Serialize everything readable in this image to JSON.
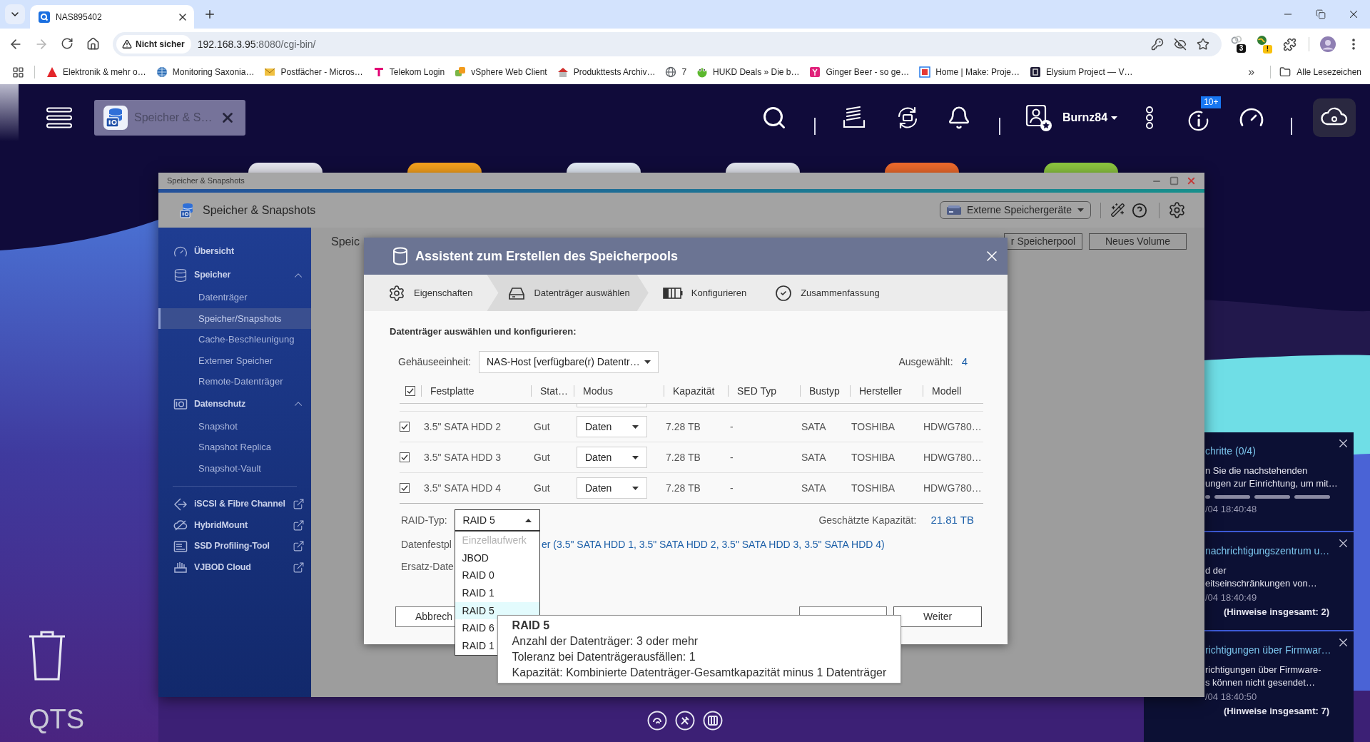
{
  "browser": {
    "tab_title": "NAS895402",
    "security_label": "Nicht sicher",
    "url_host": "192.168.3.95",
    "url_rest": ":8080/cgi-bin/",
    "extension_badges": [
      "3",
      "!"
    ],
    "bookmarks": [
      {
        "label": "Elektronik & mehr o…"
      },
      {
        "label": "Monitoring Saxonia…"
      },
      {
        "label": "Postfächer - Micros…"
      },
      {
        "label": "Telekom Login"
      },
      {
        "label": "vSphere Web Client"
      },
      {
        "label": "Produkttests Archiv…"
      },
      {
        "label": "7"
      },
      {
        "label": "HUKD Deals » Die b…"
      },
      {
        "label": "Ginger Beer - so ge…"
      },
      {
        "label": "Home | Make: Proje…"
      },
      {
        "label": "Elysium Project — V…"
      }
    ],
    "more_bookmarks": "»",
    "all_bookmarks": "Alle Lesezeichen"
  },
  "taskbar": {
    "app_tab": "Speicher & S…",
    "user": "Burnz84",
    "notification_badge": "10+"
  },
  "storage_window": {
    "window_title": "Speicher & Snapshots",
    "app_title": "Speicher & Snapshots",
    "external_devices": "Externe Speichergeräte",
    "sidebar_sections": [
      {
        "items": [
          {
            "kind": "link",
            "label": "Übersicht",
            "selected": false
          },
          {
            "kind": "group",
            "label": "Speicher",
            "selected": false,
            "expanded": true,
            "children": [
              {
                "label": "Datenträger",
                "selected": false
              },
              {
                "label": "Speicher/Snapshots",
                "selected": true
              },
              {
                "label": "Cache-Beschleunigung",
                "selected": false
              },
              {
                "label": "Externer Speicher",
                "selected": false
              },
              {
                "label": "Remote-Datenträger",
                "selected": false
              }
            ]
          },
          {
            "kind": "group",
            "label": "Datenschutz",
            "selected": false,
            "expanded": true,
            "children": [
              {
                "label": "Snapshot",
                "selected": false
              },
              {
                "label": "Snapshot Replica",
                "selected": false
              },
              {
                "label": "Snapshot-Vault",
                "selected": false
              }
            ]
          }
        ]
      },
      {
        "items": [
          {
            "kind": "external",
            "label": "iSCSI & Fibre Channel",
            "selected": false
          },
          {
            "kind": "external",
            "label": "HybridMount",
            "selected": false
          },
          {
            "kind": "external",
            "label": "SSD Profiling-Tool",
            "selected": false
          },
          {
            "kind": "external",
            "label": "VJBOD Cloud",
            "selected": false
          }
        ]
      }
    ],
    "page_title": "Speic",
    "page_buttons": [
      "r Speicherpool",
      "Neues Volume"
    ]
  },
  "dialog": {
    "title": "Assistent zum Erstellen des Speicherpools",
    "steps": [
      {
        "label": "Eigenschaften",
        "selected": false
      },
      {
        "label": "Datenträger auswählen",
        "selected": true
      },
      {
        "label": "Konfigurieren",
        "selected": false
      },
      {
        "label": "Zusammenfassung",
        "selected": false
      }
    ],
    "heading": "Datenträger auswählen und konfigurieren:",
    "enclosure": {
      "label": "Gehäuseeinheit:",
      "value": "NAS-Host [verfügbare(r) Datentr…"
    },
    "selected_count": {
      "label": "Ausgewählt:",
      "value": "4"
    },
    "table": {
      "all_checked": true,
      "partial_row_above": true,
      "columns": [
        "Festplatte",
        "Stat…",
        "Modus",
        "Kapazität",
        "SED Typ",
        "Bustyp",
        "Hersteller",
        "Modell"
      ],
      "rows": [
        {
          "checked": true,
          "disk": "3.5\" SATA HDD 2",
          "status": "Gut",
          "mode": "Daten",
          "capacity": "7.28 TB",
          "sed": "-",
          "bus": "SATA",
          "vendor": "TOSHIBA",
          "model": "HDWG780…"
        },
        {
          "checked": true,
          "disk": "3.5\" SATA HDD 3",
          "status": "Gut",
          "mode": "Daten",
          "capacity": "7.28 TB",
          "sed": "-",
          "bus": "SATA",
          "vendor": "TOSHIBA",
          "model": "HDWG780…"
        },
        {
          "checked": true,
          "disk": "3.5\" SATA HDD 4",
          "status": "Gut",
          "mode": "Daten",
          "capacity": "7.28 TB",
          "sed": "-",
          "bus": "SATA",
          "vendor": "TOSHIBA",
          "model": "HDWG780…"
        }
      ]
    },
    "raid": {
      "label": "RAID-Typ:",
      "value": "RAID 5",
      "expanded": true,
      "options": [
        {
          "label": "Einzellaufwerk",
          "disabled": true,
          "selected": false
        },
        {
          "label": "JBOD",
          "disabled": false,
          "selected": false
        },
        {
          "label": "RAID 0",
          "disabled": false,
          "selected": false
        },
        {
          "label": "RAID 1",
          "disabled": false,
          "selected": false
        },
        {
          "label": "RAID 5",
          "disabled": false,
          "selected": true
        },
        {
          "label": "RAID 6",
          "disabled": false,
          "selected": false
        },
        {
          "label": "RAID 1",
          "disabled": false,
          "selected": false
        }
      ]
    },
    "tooltip": {
      "title": "RAID 5",
      "lines": [
        "Anzahl der Datenträger: 3 oder mehr",
        "Toleranz bei Datenträgerausfällen: 1",
        "Kapazität: Kombinierte Datenträger-Gesamtkapazität minus 1 Datenträger"
      ]
    },
    "estimate": {
      "label": "Geschätzte Kapazität:",
      "value": "21.81 TB"
    },
    "disks": {
      "label": "Datenfestpl",
      "value": "er (3.5\" SATA HDD 1, 3.5\" SATA HDD 2, 3.5\" SATA HDD 3, 3.5\" SATA HDD 4)"
    },
    "spare": {
      "label": "Ersatz-Date"
    },
    "buttons": {
      "cancel": "Abbrech",
      "covered_middle": true,
      "next": "Weiter"
    }
  },
  "notifications": [
    {
      "kind": "progress",
      "title": "chritte (0/4)",
      "lines": [
        "n Sie die nachstehenden",
        "ungen zur Einrichtung, um mit…"
      ],
      "time": "/04 18:40:48"
    },
    {
      "kind": "message",
      "title": "nachrichtigungszentrum u…",
      "lines": [
        "d der",
        "eitseinschränkungen von…"
      ],
      "time": "/04 18:40:49",
      "total": "(Hinweise insgesamt: 2)"
    },
    {
      "kind": "message",
      "title": "richtigungen über Firmwar…",
      "lines": [
        "richtigungen über Firmware-",
        "s können nicht gesendet…"
      ],
      "time": "/04 18:40:50",
      "total": "(Hinweise insgesamt: 7)"
    }
  ],
  "desktop": {
    "logo_text": "QTS"
  }
}
